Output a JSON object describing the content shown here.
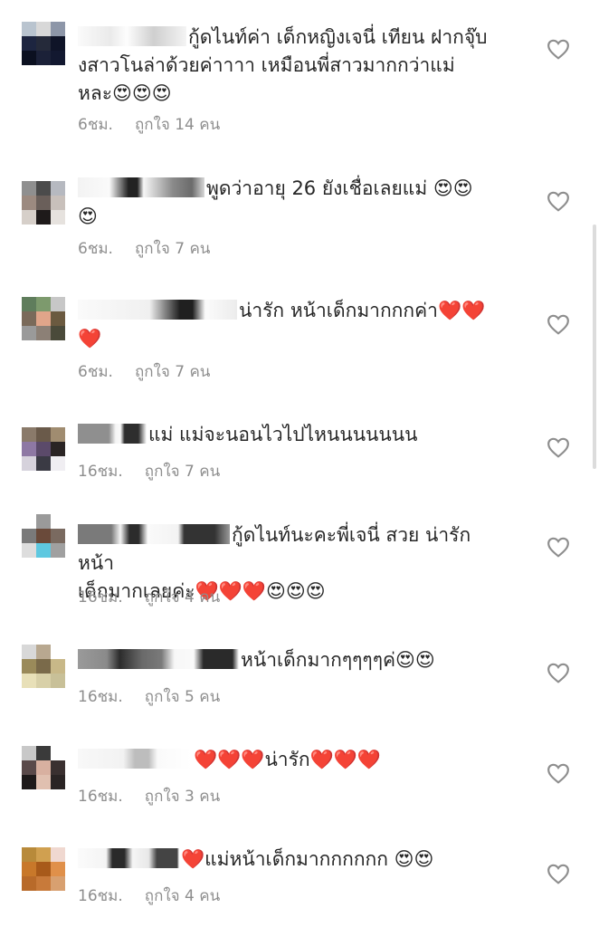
{
  "comments": [
    {
      "text": "กู้ดไนท์ค่า เด็กหญิงเจนี่ เทียน ฝากจุ๊บ\nงสาวโนล่าด้วยค่าาาา เหมือนพี่สาวมากกว่าแม่\nหละ😍😍😍",
      "time": "6ชม.",
      "likes": "ถูกใจ 14 คน"
    },
    {
      "text": "พูดว่าอายุ 26 ยังเชื่อเลยแม่ 😍😍\n😍",
      "time": "6ชม.",
      "likes": "ถูกใจ 7 คน"
    },
    {
      "text": "น่ารัก หน้าเด็กมากกกค่า❤️❤️\n❤️",
      "time": "6ชม.",
      "likes": "ถูกใจ 7 คน"
    },
    {
      "text": "แม่ แม่จะนอนไวไปไหนนนนนนน",
      "time": "16ชม.",
      "likes": "ถูกใจ 7 คน"
    },
    {
      "text": "กู้ดไนท์นะคะพี่เจนี่ สวย น่ารัก หน้า\nเด็กมากเลยค่ะ❤️❤️❤️😍😍😍",
      "time": "16ชม.",
      "likes": "ถูกใจ 4 คน"
    },
    {
      "text": "หน้าเด็กมากๆๆๆๆค่😍😍",
      "time": "16ชม.",
      "likes": "ถูกใจ 5 คน"
    },
    {
      "text": "❤️❤️❤️น่ารัก❤️❤️❤️",
      "time": "16ชม.",
      "likes": "ถูกใจ 3 คน"
    },
    {
      "text": "❤️แม่หน้าเด็กมากกกกกก 😍😍",
      "time": "16ชม.",
      "likes": "ถูกใจ 4 คน"
    }
  ],
  "colors": {
    "text": "#262626",
    "meta": "#8e8e8e",
    "heart_outline": "#8e8e8e"
  },
  "icons": {
    "like": "heart-outline-icon",
    "avatar": "blurred-avatar"
  }
}
